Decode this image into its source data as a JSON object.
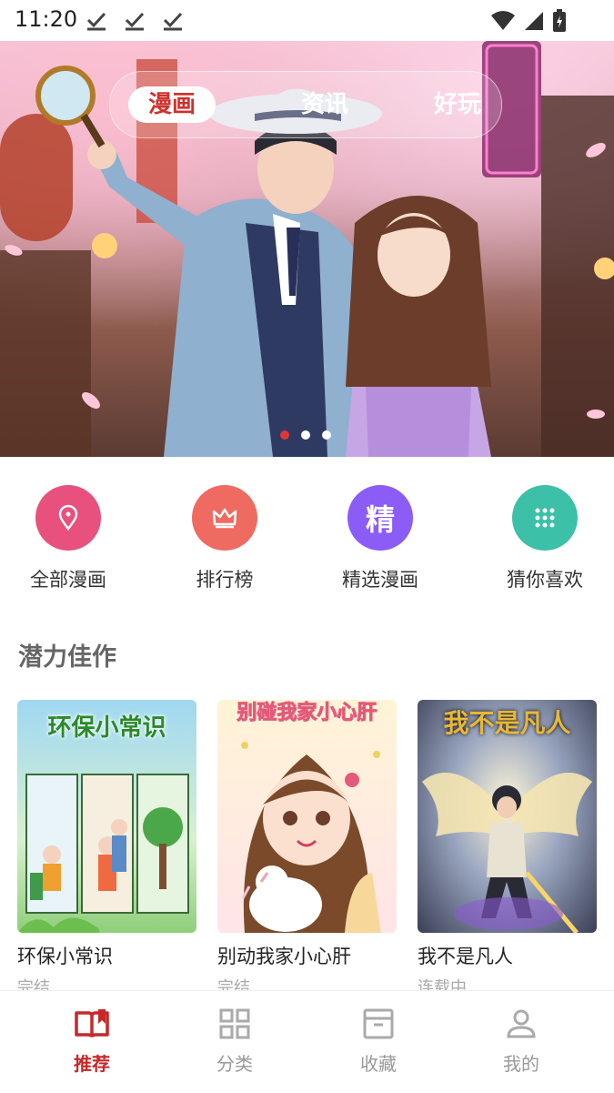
{
  "status_bar": {
    "time": "11:20"
  },
  "banner": {
    "tabs": [
      {
        "label": "漫画",
        "active": true
      },
      {
        "label": "资讯",
        "active": false
      },
      {
        "label": "好玩",
        "active": false
      }
    ],
    "carousel_index": 1,
    "carousel_count": 3
  },
  "categories": [
    {
      "label": "全部漫画",
      "icon": "location-pin-icon",
      "color": "#e8507e"
    },
    {
      "label": "排行榜",
      "icon": "crown-icon",
      "color": "#ef6a60"
    },
    {
      "label": "精选漫画",
      "icon": "selected-badge-icon",
      "glyph": "精",
      "color": "#8b5cf6"
    },
    {
      "label": "猜你喜欢",
      "icon": "grid-dots-icon",
      "color": "#3cc0a8"
    }
  ],
  "section": {
    "title": "潜力佳作"
  },
  "comics": [
    {
      "cover_title": "环保小常识",
      "name": "环保小常识",
      "status": "完结"
    },
    {
      "cover_title": "别碰我家小心肝",
      "name": "别动我家小心肝",
      "status": "完结"
    },
    {
      "cover_title": "我不是凡人",
      "name": "我不是凡人",
      "status": "连载中"
    }
  ],
  "bottom_nav": [
    {
      "label": "推荐",
      "icon": "open-book-icon",
      "active": true
    },
    {
      "label": "分类",
      "icon": "grid-icon",
      "active": false
    },
    {
      "label": "收藏",
      "icon": "archive-box-icon",
      "active": false
    },
    {
      "label": "我的",
      "icon": "person-icon",
      "active": false
    }
  ],
  "colors": {
    "accent": "#c62828",
    "inactive": "#999999"
  }
}
